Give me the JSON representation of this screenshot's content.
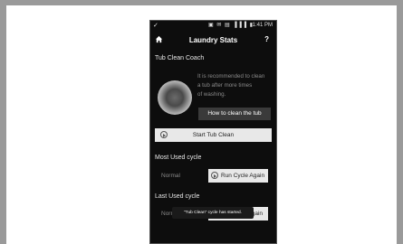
{
  "status_bar": {
    "check": "✓",
    "icons": "▣ ✉ ▤ ▐▐▐ ▮",
    "time": "1:41 PM"
  },
  "app_bar": {
    "title": "Laundry Stats",
    "help": "?"
  },
  "tub_clean": {
    "heading": "Tub Clean Coach",
    "line1": "It is recommended to clean",
    "line2": "a tub after   more times",
    "line3": "of washing.",
    "how_to_button": "How to clean the tub",
    "start_button": "Start Tub Clean"
  },
  "most_used": {
    "heading": "Most Used cycle",
    "cycle": "Normal",
    "run_button": "Run Cycle Again"
  },
  "last_used": {
    "heading": "Last Used cycle",
    "cycle": "Norm",
    "run_button": "Again"
  },
  "toast": "\"Tub Clean\" cycle has started."
}
